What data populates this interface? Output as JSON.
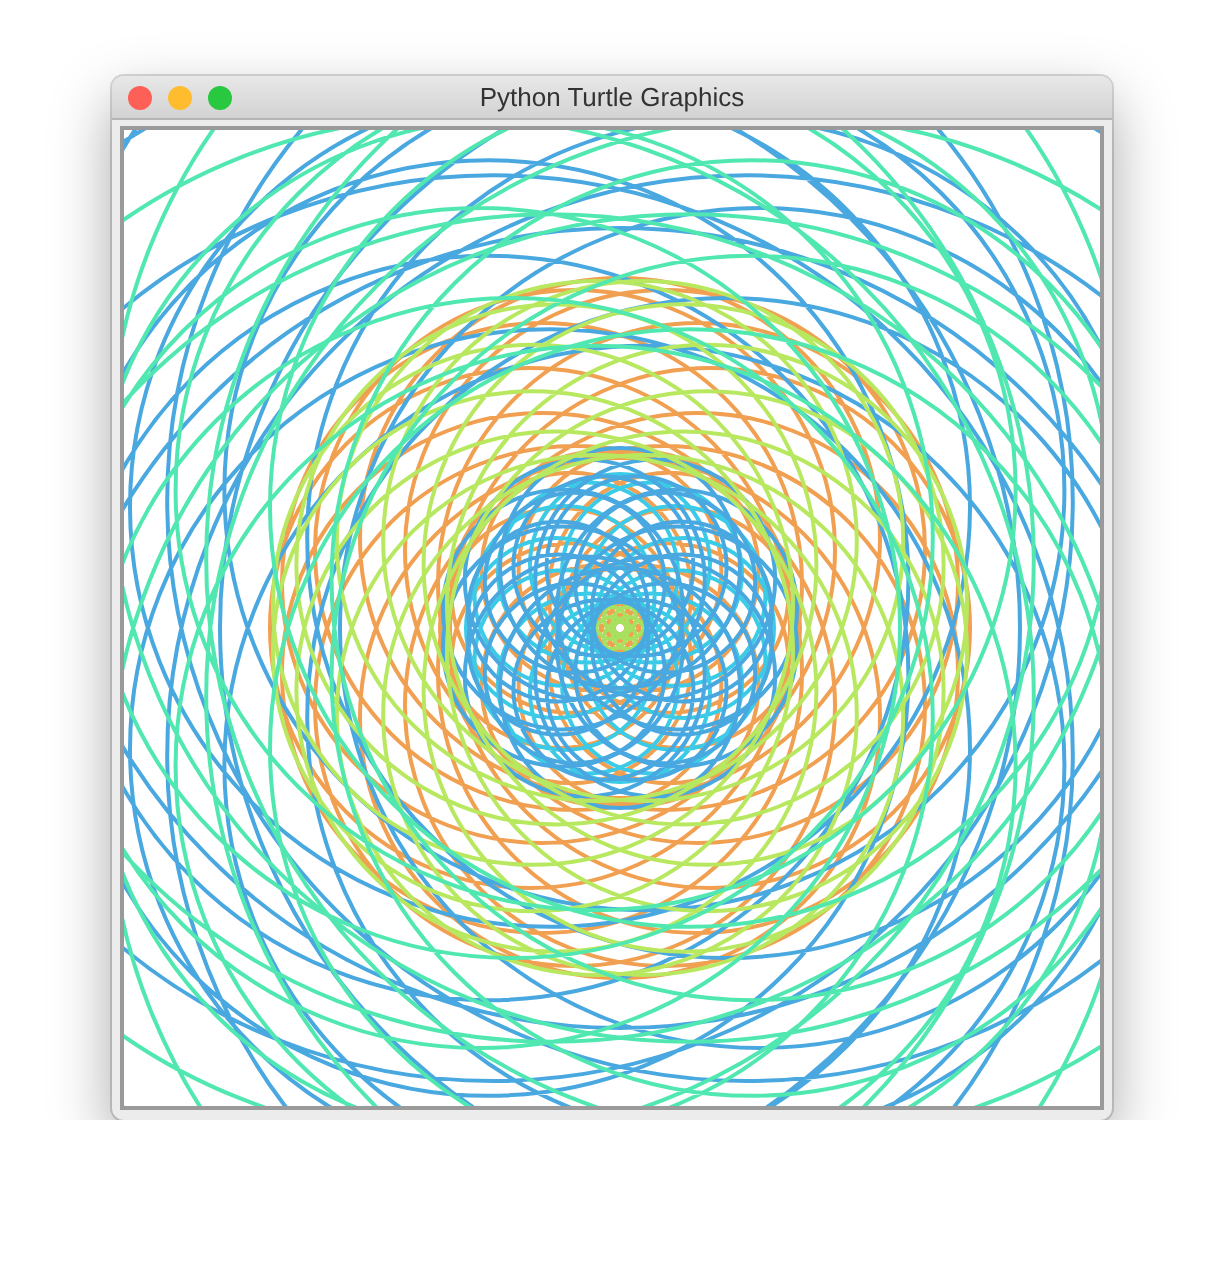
{
  "window": {
    "title": "Python Turtle Graphics"
  }
}
